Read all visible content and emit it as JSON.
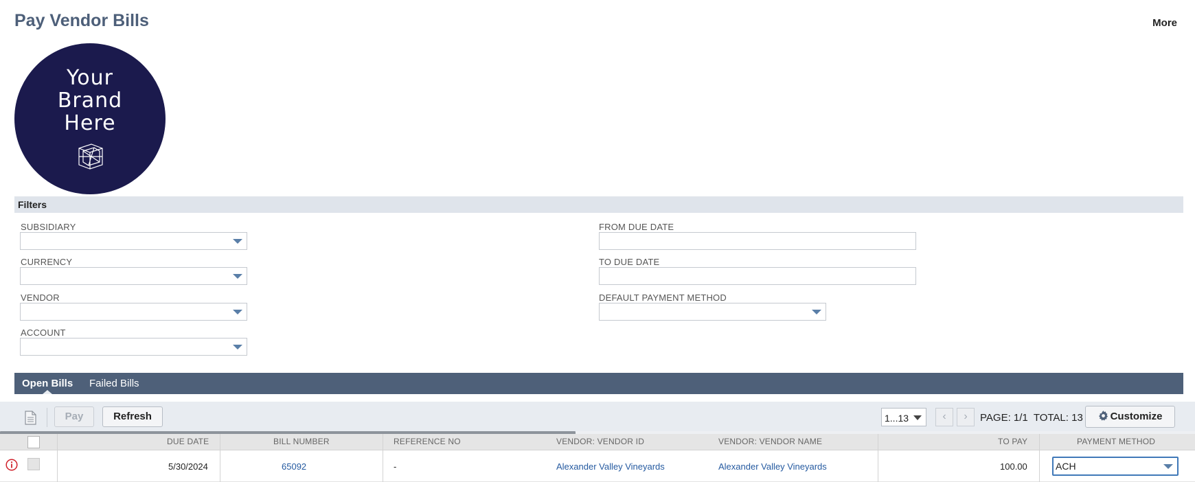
{
  "header": {
    "title": "Pay Vendor Bills",
    "more_label": "More"
  },
  "brand": {
    "text": "Your\nBrand\nHere",
    "icon": "cube-icon",
    "background": "#1b1a4d"
  },
  "filters": {
    "section_label": "Filters",
    "subsidiary_label": "SUBSIDIARY",
    "subsidiary_value": "",
    "currency_label": "CURRENCY",
    "currency_value": "",
    "vendor_label": "VENDOR",
    "vendor_value": "",
    "account_label": "ACCOUNT",
    "account_value": "",
    "from_due_date_label": "FROM DUE DATE",
    "from_due_date_value": "",
    "to_due_date_label": "TO DUE DATE",
    "to_due_date_value": "",
    "default_payment_method_label": "DEFAULT PAYMENT METHOD",
    "default_payment_method_value": ""
  },
  "tabs": [
    {
      "label": "Open Bills",
      "active": true
    },
    {
      "label": "Failed Bills",
      "active": false
    }
  ],
  "toolbar": {
    "pay_label": "Pay",
    "refresh_label": "Refresh",
    "range_value": "1...13",
    "prev_icon": "chevron-left-icon",
    "next_icon": "chevron-right-icon",
    "page_info": "PAGE: 1/1  TOTAL: 13",
    "customize_label": "Customize"
  },
  "grid": {
    "columns": {
      "due_date": "DUE DATE",
      "bill_number": "BILL NUMBER",
      "reference_no": "REFERENCE NO",
      "vendor_id": "VENDOR: VENDOR ID",
      "vendor_name": "VENDOR: VENDOR NAME",
      "to_pay": "TO PAY",
      "payment_method": "PAYMENT METHOD"
    },
    "rows": [
      {
        "due_date": "5/30/2024",
        "bill_number": "65092",
        "reference_no": "-",
        "vendor_id": "Alexander Valley Vineyards",
        "vendor_name": "Alexander Valley Vineyards",
        "to_pay": "100.00",
        "payment_method": "ACH",
        "status_icon": "warning-icon"
      }
    ]
  },
  "colors": {
    "title": "#4d5f79",
    "tabbar": "#4e6079",
    "filters_bar": "#dfe4eb",
    "toolbar": "#e8ecf1",
    "link": "#255aa0",
    "warning": "#d0202a"
  }
}
